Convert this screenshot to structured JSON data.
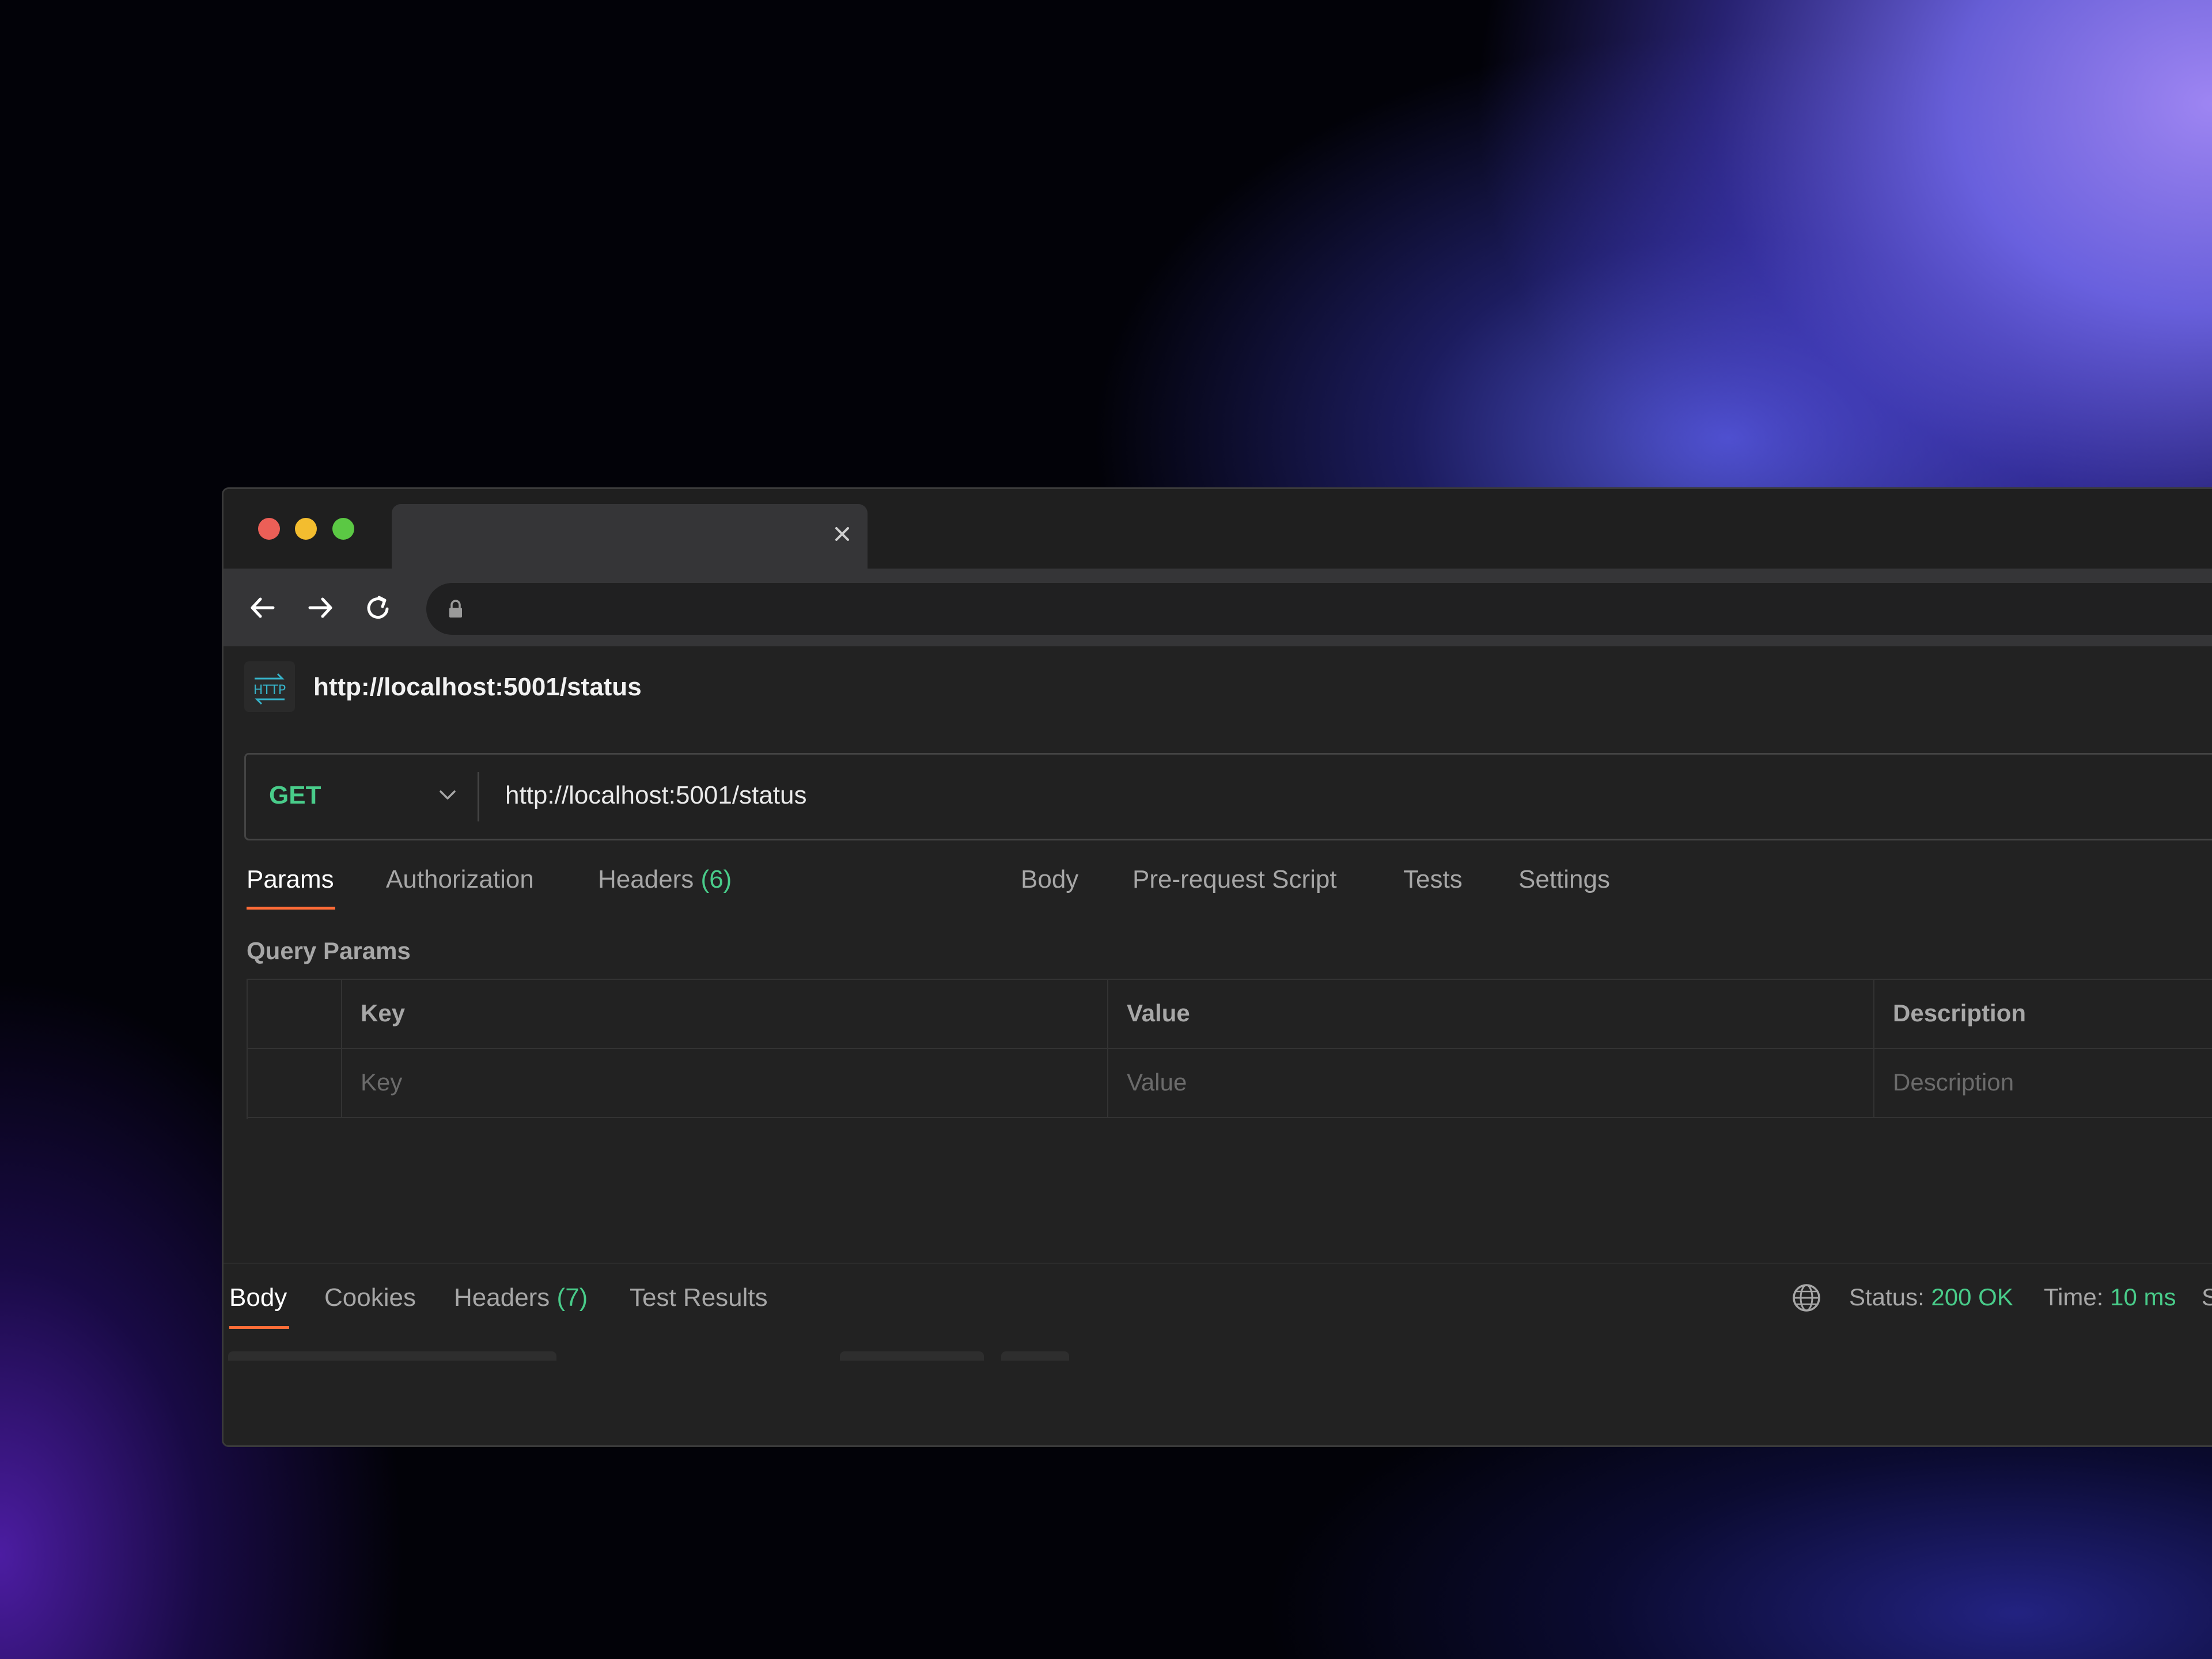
{
  "request": {
    "title": "http://localhost:5001/status",
    "method": "GET",
    "url": "http://localhost:5001/status"
  },
  "request_tabs": {
    "params": "Params",
    "authorization": "Authorization",
    "headers": "Headers",
    "headers_count": "(6)",
    "body": "Body",
    "pre_request": "Pre-request Script",
    "tests": "Tests",
    "settings": "Settings"
  },
  "query_params": {
    "label": "Query Params",
    "headers": [
      "Key",
      "Value",
      "Description"
    ],
    "placeholders": [
      "Key",
      "Value",
      "Description"
    ]
  },
  "response_tabs": {
    "body": "Body",
    "cookies": "Cookies",
    "headers": "Headers",
    "headers_count": "(7)",
    "test_results": "Test Results"
  },
  "response_status": {
    "status_label": "Status:",
    "status_value": "200 OK",
    "time_label": "Time:",
    "time_value": "10 ms",
    "size_label_partial": "S"
  },
  "colors": {
    "method_get": "#49cc8a",
    "active_underline": "#ff6c37",
    "count_green": "#49cc8a"
  },
  "icons": [
    "close-icon",
    "back-arrow-icon",
    "forward-arrow-icon",
    "reload-icon",
    "lock-icon",
    "http-request-icon",
    "chevron-down-icon",
    "globe-icon"
  ]
}
